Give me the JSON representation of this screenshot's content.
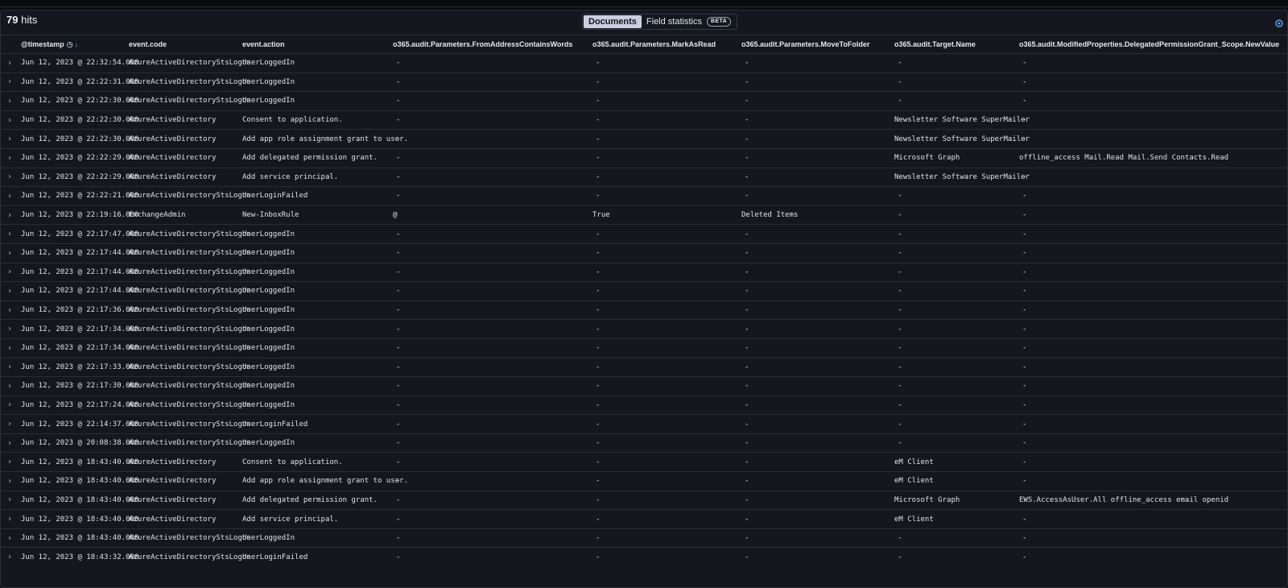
{
  "hits": {
    "count": "79",
    "label": "hits"
  },
  "view_tabs": [
    {
      "label": "Documents",
      "active": true
    },
    {
      "label": "Field statistics",
      "active": false,
      "badge": "BETA"
    }
  ],
  "columns": [
    "@timestamp",
    "event.code",
    "event.action",
    "o365.audit.Parameters.FromAddressContainsWords",
    "o365.audit.Parameters.MarkAsRead",
    "o365.audit.Parameters.MoveToFolder",
    "o365.audit.Target.Name",
    "o365.audit.ModifiedProperties.DelegatedPermissionGrant_Scope.NewValue"
  ],
  "rows": [
    [
      "Jun 12, 2023 @ 22:32:54.000",
      "AzureActiveDirectoryStsLogon",
      "UserLoggedIn",
      "-",
      "-",
      "-",
      "-",
      "-"
    ],
    [
      "Jun 12, 2023 @ 22:22:31.000",
      "AzureActiveDirectoryStsLogon",
      "UserLoggedIn",
      "-",
      "-",
      "-",
      "-",
      "-"
    ],
    [
      "Jun 12, 2023 @ 22:22:30.000",
      "AzureActiveDirectoryStsLogon",
      "UserLoggedIn",
      "-",
      "-",
      "-",
      "-",
      "-"
    ],
    [
      "Jun 12, 2023 @ 22:22:30.000",
      "AzureActiveDirectory",
      "Consent to application.",
      "-",
      "-",
      "-",
      "Newsletter Software SuperMailer",
      "-"
    ],
    [
      "Jun 12, 2023 @ 22:22:30.000",
      "AzureActiveDirectory",
      "Add app role assignment grant to user.",
      "-",
      "-",
      "-",
      "Newsletter Software SuperMailer",
      "-"
    ],
    [
      "Jun 12, 2023 @ 22:22:29.000",
      "AzureActiveDirectory",
      "Add delegated permission grant.",
      "-",
      "-",
      "-",
      "Microsoft Graph",
      "offline_access Mail.Read Mail.Send Contacts.Read"
    ],
    [
      "Jun 12, 2023 @ 22:22:29.000",
      "AzureActiveDirectory",
      "Add service principal.",
      "-",
      "-",
      "-",
      "Newsletter Software SuperMailer",
      "-"
    ],
    [
      "Jun 12, 2023 @ 22:22:21.000",
      "AzureActiveDirectoryStsLogon",
      "UserLoginFailed",
      "-",
      "-",
      "-",
      "-",
      "-"
    ],
    [
      "Jun 12, 2023 @ 22:19:16.000",
      "ExchangeAdmin",
      "New-InboxRule",
      "@",
      "True",
      "Deleted Items",
      "-",
      "-"
    ],
    [
      "Jun 12, 2023 @ 22:17:47.000",
      "AzureActiveDirectoryStsLogon",
      "UserLoggedIn",
      "-",
      "-",
      "-",
      "-",
      "-"
    ],
    [
      "Jun 12, 2023 @ 22:17:44.000",
      "AzureActiveDirectoryStsLogon",
      "UserLoggedIn",
      "-",
      "-",
      "-",
      "-",
      "-"
    ],
    [
      "Jun 12, 2023 @ 22:17:44.000",
      "AzureActiveDirectoryStsLogon",
      "UserLoggedIn",
      "-",
      "-",
      "-",
      "-",
      "-"
    ],
    [
      "Jun 12, 2023 @ 22:17:44.000",
      "AzureActiveDirectoryStsLogon",
      "UserLoggedIn",
      "-",
      "-",
      "-",
      "-",
      "-"
    ],
    [
      "Jun 12, 2023 @ 22:17:36.000",
      "AzureActiveDirectoryStsLogon",
      "UserLoggedIn",
      "-",
      "-",
      "-",
      "-",
      "-"
    ],
    [
      "Jun 12, 2023 @ 22:17:34.000",
      "AzureActiveDirectoryStsLogon",
      "UserLoggedIn",
      "-",
      "-",
      "-",
      "-",
      "-"
    ],
    [
      "Jun 12, 2023 @ 22:17:34.000",
      "AzureActiveDirectoryStsLogon",
      "UserLoggedIn",
      "-",
      "-",
      "-",
      "-",
      "-"
    ],
    [
      "Jun 12, 2023 @ 22:17:33.000",
      "AzureActiveDirectoryStsLogon",
      "UserLoggedIn",
      "-",
      "-",
      "-",
      "-",
      "-"
    ],
    [
      "Jun 12, 2023 @ 22:17:30.000",
      "AzureActiveDirectoryStsLogon",
      "UserLoggedIn",
      "-",
      "-",
      "-",
      "-",
      "-"
    ],
    [
      "Jun 12, 2023 @ 22:17:24.000",
      "AzureActiveDirectoryStsLogon",
      "UserLoggedIn",
      "-",
      "-",
      "-",
      "-",
      "-"
    ],
    [
      "Jun 12, 2023 @ 22:14:37.000",
      "AzureActiveDirectoryStsLogon",
      "UserLoginFailed",
      "-",
      "-",
      "-",
      "-",
      "-"
    ],
    [
      "Jun 12, 2023 @ 20:08:38.000",
      "AzureActiveDirectoryStsLogon",
      "UserLoggedIn",
      "-",
      "-",
      "-",
      "-",
      "-"
    ],
    [
      "Jun 12, 2023 @ 18:43:40.000",
      "AzureActiveDirectory",
      "Consent to application.",
      "-",
      "-",
      "-",
      "eM Client",
      "-"
    ],
    [
      "Jun 12, 2023 @ 18:43:40.000",
      "AzureActiveDirectory",
      "Add app role assignment grant to user.",
      "-",
      "-",
      "-",
      "eM Client",
      "-"
    ],
    [
      "Jun 12, 2023 @ 18:43:40.000",
      "AzureActiveDirectory",
      "Add delegated permission grant.",
      "-",
      "-",
      "-",
      "Microsoft Graph",
      "EWS.AccessAsUser.All offline_access email openid"
    ],
    [
      "Jun 12, 2023 @ 18:43:40.000",
      "AzureActiveDirectory",
      "Add service principal.",
      "-",
      "-",
      "-",
      "eM Client",
      "-"
    ],
    [
      "Jun 12, 2023 @ 18:43:40.000",
      "AzureActiveDirectoryStsLogon",
      "UserLoggedIn",
      "-",
      "-",
      "-",
      "-",
      "-"
    ],
    [
      "Jun 12, 2023 @ 18:43:32.000",
      "AzureActiveDirectoryStsLogon",
      "UserLoginFailed",
      "-",
      "-",
      "-",
      "-",
      "-"
    ]
  ],
  "icons": {
    "sort": "clock-icon",
    "sort_direction": "arrow-down-icon",
    "expand": "chevron-right-icon"
  },
  "colors": {
    "accent": "#5aa7ff",
    "background": "#15171e",
    "active_tab": "#c8cfe0"
  }
}
